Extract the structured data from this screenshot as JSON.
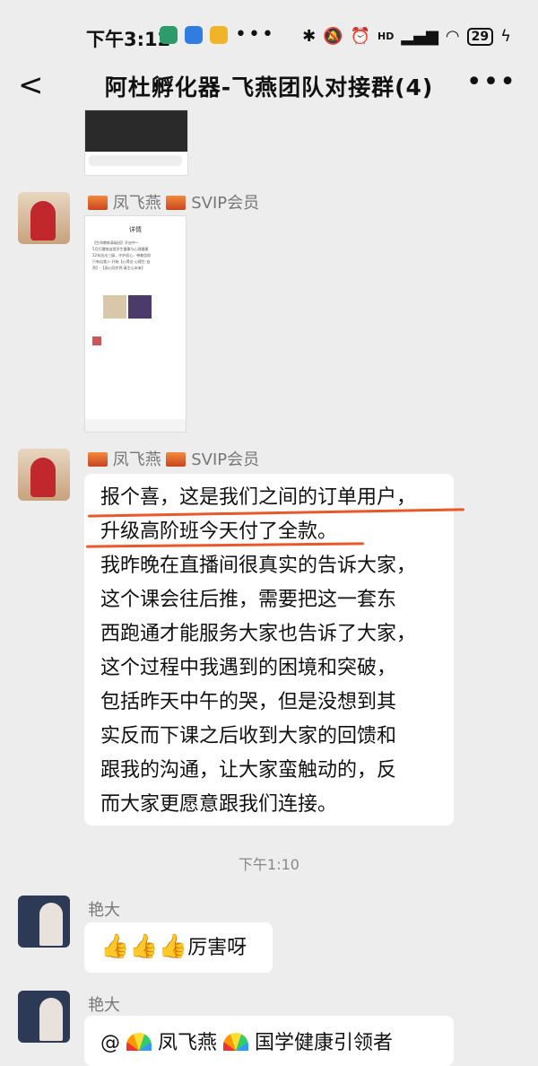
{
  "status": {
    "time": "下午3:12",
    "battery": "29",
    "network": "HD"
  },
  "header": {
    "title": "阿杜孵化器-飞燕团队对接群(4)"
  },
  "messages": [
    {
      "sender": "凤飞燕",
      "badge": "SVIP会员"
    },
    {
      "sender": "凤飞燕",
      "badge": "SVIP会员",
      "lines": [
        "报个喜，这是我们之间的订单用户，",
        "升级高阶班今天付了全款。",
        "我昨晚在直播间很真实的告诉大家，",
        "这个课会往后推，需要把这一套东",
        "西跑通才能服务大家也告诉了大家，",
        "这个过程中我遇到的困境和突破，",
        "包括昨天中午的哭，但是没想到其",
        "实反而下课之后收到大家的回馈和",
        "跟我的沟通，让大家蛮触动的，反",
        "而大家更愿意跟我们连接。"
      ]
    },
    {
      "sender": "艳大",
      "text": "厉害呀"
    },
    {
      "sender": "艳大",
      "mention": "@",
      "mention_name": "凤飞燕",
      "mention_title": "国学健康引领者"
    }
  ],
  "timestamp": "下午1:10",
  "screenshot_text": {
    "header": "详情",
    "lines": [
      "【生命教练高级班】开启中~",
      "5月打磨暗自国学生健康与心理健康",
      "22年抗击三级，守护初心，带着信仰",
      "只有自我人-开始【心得业-心理生-自",
      "然】-【身心同步养-真生心未来】"
    ]
  },
  "colors": {
    "accent_underline": "#e8582a",
    "background": "#ededed",
    "bubble": "#ffffff"
  }
}
